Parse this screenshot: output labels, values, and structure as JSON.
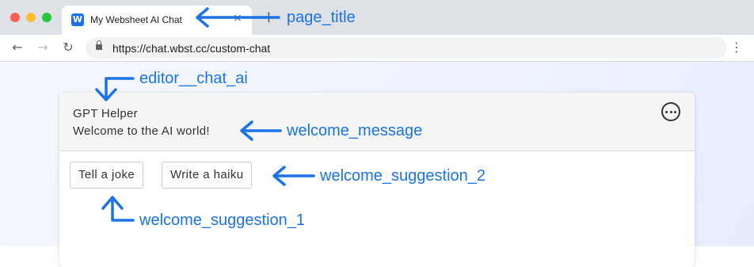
{
  "browser": {
    "tab_title": "My Websheet AI Chat",
    "favicon_letter": "W",
    "tab_close": "×",
    "new_tab": "+",
    "back": "←",
    "forward": "→",
    "reload": "↻",
    "url": "https://chat.wbst.cc/custom-chat",
    "menu": "⋮"
  },
  "chat": {
    "name": "GPT Helper",
    "welcome_message": "Welcome to the AI world!",
    "suggestions": [
      "Tell a joke",
      "Write a haiku"
    ]
  },
  "annotations": {
    "page_title": "page_title",
    "editor_chat_ai": "editor__chat_ai",
    "welcome_message": "welcome_message",
    "welcome_suggestion_2": "welcome_suggestion_2",
    "welcome_suggestion_1": "welcome_suggestion_1"
  },
  "colors": {
    "annotation": "#1a73e8",
    "tab_strip": "#dee1e6",
    "favicon": "#1a73e8"
  }
}
